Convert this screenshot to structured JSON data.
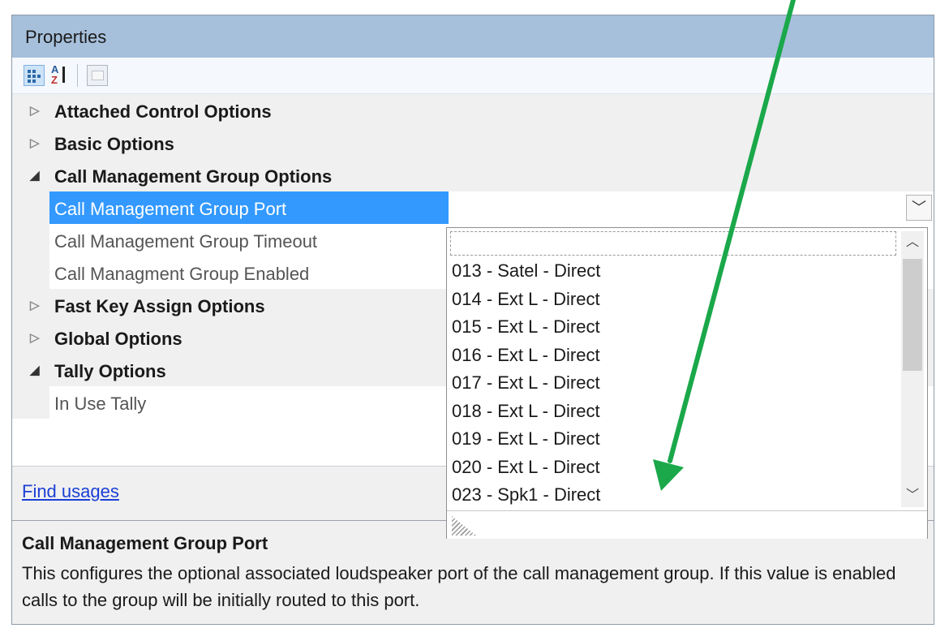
{
  "panel": {
    "title": "Properties",
    "toolbar": {
      "categorized_icon": "categorized-icon",
      "alphabetical_icon": "sort-alphabetical-icon",
      "property_pages_icon": "property-pages-icon",
      "az_top": "A",
      "az_bottom": "Z"
    },
    "grid": {
      "rows": [
        {
          "type": "category",
          "label": "Attached Control Options",
          "expanded": false
        },
        {
          "type": "category",
          "label": "Basic Options",
          "expanded": false
        },
        {
          "type": "category",
          "label": "Call Management Group Options",
          "expanded": true
        },
        {
          "type": "property",
          "label": "Call Management Group Port",
          "selected": true
        },
        {
          "type": "property",
          "label": "Call Management Group Timeout"
        },
        {
          "type": "property",
          "label": "Call Managment Group Enabled"
        },
        {
          "type": "category",
          "label": "Fast Key Assign Options",
          "expanded": false
        },
        {
          "type": "category",
          "label": "Global Options",
          "expanded": false
        },
        {
          "type": "category",
          "label": "Tally Options",
          "expanded": true
        },
        {
          "type": "property",
          "label": "In Use Tally"
        }
      ],
      "expand_glyph": "▷",
      "collapse_glyph": "◢",
      "dropdown_button_glyph": "﹀"
    },
    "find_usages": "Find usages",
    "description": {
      "title": "Call Management Group Port",
      "body": "This configures the optional associated loudspeaker port of the call management group. If this value is enabled calls to the group will be initially routed to this port."
    }
  },
  "dropdown": {
    "input_value": "",
    "options": [
      "013 - Satel - Direct",
      "014 - Ext L - Direct",
      "015 - Ext L - Direct",
      "016 - Ext L - Direct",
      "017 - Ext L - Direct",
      "018 - Ext L - Direct",
      "019 - Ext L - Direct",
      "020 - Ext L - Direct",
      "023 - Spk1 - Direct"
    ],
    "scroll_up_glyph": "︿",
    "scroll_down_glyph": "﹀",
    "scroll_position": 0.1
  },
  "annotation": {
    "color": "#1aa84a"
  }
}
